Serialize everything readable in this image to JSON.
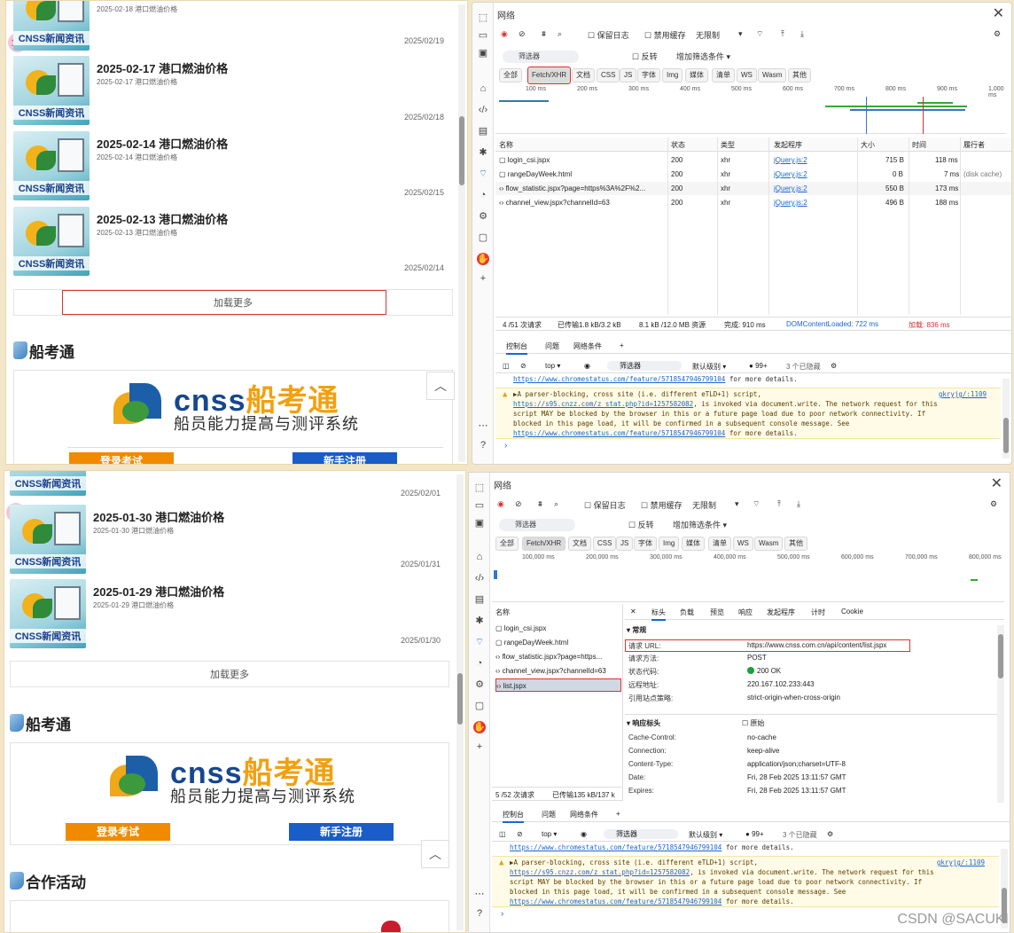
{
  "left_top": {
    "news": [
      {
        "title": "",
        "sub": "2025-02-18 港口燃油价格",
        "date": "2025/02/19"
      },
      {
        "title": "2025-02-17 港口燃油价格",
        "sub": "2025-02-17 港口燃油价格",
        "date": "2025/02/18"
      },
      {
        "title": "2025-02-14 港口燃油价格",
        "sub": "2025-02-14 港口燃油价格",
        "date": "2025/02/15"
      },
      {
        "title": "2025-02-13 港口燃油价格",
        "sub": "2025-02-13 港口燃油价格",
        "date": "2025/02/14"
      }
    ],
    "thumb_caption": "CNSS新闻资讯",
    "load_more": "加载更多",
    "section_title": "船考通",
    "logo_en": "cnss",
    "logo_cn": "船考通",
    "slogan": "船员能力提高与测评系统",
    "btn_exam": "登录考试",
    "btn_reg": "新手注册",
    "translate_badge": "文A"
  },
  "left_bottom": {
    "news": [
      {
        "title": "",
        "sub": "",
        "date": "2025/02/01"
      },
      {
        "title": "2025-01-30 港口燃油价格",
        "sub": "2025-01-30 港口燃油价格",
        "date": "2025/01/31"
      },
      {
        "title": "2025-01-29 港口燃油价格",
        "sub": "2025-01-29 港口燃油价格",
        "date": "2025/01/30"
      }
    ],
    "thumb_caption": "CNSS新闻资讯",
    "load_more": "加载更多",
    "section_title": "船考通",
    "section2_title": "合作活动",
    "logo_en": "cnss",
    "logo_cn": "船考通",
    "slogan": "船员能力提高与测评系统",
    "btn_exam": "登录考试",
    "btn_reg": "新手注册",
    "translate_badge": "文A"
  },
  "devtools": {
    "title": "网络",
    "preserve_log": "保留日志",
    "disable_cache": "禁用缓存",
    "throttle": "无限制",
    "filter": "筛选器",
    "invert": "反转",
    "more_filters": "增加筛选条件",
    "type_chips": [
      "全部",
      "Fetch/XHR",
      "文档",
      "CSS",
      "JS",
      "字体",
      "Img",
      "媒体",
      "清单",
      "WS",
      "Wasm",
      "其他"
    ],
    "ticks_top": [
      "100 ms",
      "200 ms",
      "300 ms",
      "400 ms",
      "500 ms",
      "600 ms",
      "700 ms",
      "800 ms",
      "900 ms",
      "1,000 ms"
    ],
    "ticks_bottom": [
      "100,000 ms",
      "200,000 ms",
      "300,000 ms",
      "400,000 ms",
      "500,000 ms",
      "600,000 ms",
      "700,000 ms",
      "800,000 ms"
    ],
    "columns": [
      "名称",
      "状态",
      "类型",
      "发起程序",
      "大小",
      "时间",
      "履行者"
    ],
    "rows": [
      {
        "name": "login_csi.jspx",
        "status": "200",
        "type": "xhr",
        "init": "jQuery.js:2",
        "size": "715 B",
        "time": "118 ms",
        "fulfilled": ""
      },
      {
        "name": "rangeDayWeek.html",
        "status": "200",
        "type": "xhr",
        "init": "jQuery.js:2",
        "size": "0 B",
        "time": "7 ms",
        "fulfilled": "(disk cache)"
      },
      {
        "name": "flow_statistic.jspx?page=https%3A%2F%2...",
        "status": "200",
        "type": "xhr",
        "init": "jQuery.js:2",
        "size": "550 B",
        "time": "173 ms",
        "fulfilled": ""
      },
      {
        "name": "channel_view.jspx?channelId=63",
        "status": "200",
        "type": "xhr",
        "init": "jQuery.js:2",
        "size": "496 B",
        "time": "188 ms",
        "fulfilled": ""
      }
    ],
    "summary": {
      "requests": "4 /51 次请求",
      "transferred": "已传输1.8 kB/3.2 kB",
      "resources": "8.1 kB /12.0 MB 资源",
      "finish": "完成: 910 ms",
      "dcl": "DOMContentLoaded: 722 ms",
      "load": "加载: 836 ms"
    },
    "drawer_tabs": [
      "控制台",
      "问题",
      "网络条件"
    ],
    "console_context": "top",
    "console_filter": "筛选器",
    "console_level": "默认级别",
    "issue_count": "99+",
    "hidden_count": "3 个已隐藏",
    "console_link_line": "https://www.chromestatus.com/feature/5718547946799104",
    "console_link_tail": " for more details.",
    "warn_prefix": "▶A parser-blocking, cross site (i.e. different eTLD+1) script,",
    "warn_link": "https://s95.cnzz.com/z_stat.php?id=1257582082",
    "warn_l2_tail": ", is invoked via document.write. The network request for this",
    "warn_l3": "script MAY be blocked by the browser in this or a future page load due to poor network connectivity. If",
    "warn_l4": "blocked in this page load, it will be confirmed in a subsequent console message. See",
    "warn_src": "gkryjg/:1109"
  },
  "devtools2": {
    "names": [
      "login_csi.jspx",
      "rangeDayWeek.html",
      "flow_statistic.jspx?page=https...",
      "channel_view.jspx?channelId=63",
      "list.jspx"
    ],
    "panel_tabs": [
      "标头",
      "负载",
      "预览",
      "响应",
      "发起程序",
      "计时",
      "Cookie"
    ],
    "general_title": "常规",
    "general": [
      {
        "k": "请求 URL:",
        "v": "https://www.cnss.com.cn/api/content/list.jspx"
      },
      {
        "k": "请求方法:",
        "v": "POST"
      },
      {
        "k": "状态代码:",
        "v": "200 OK"
      },
      {
        "k": "远程地址:",
        "v": "220.167.102.233:443"
      },
      {
        "k": "引用站点策略:",
        "v": "strict-origin-when-cross-origin"
      }
    ],
    "resp_title": "响应标头",
    "raw": "原始",
    "resp": [
      {
        "k": "Cache-Control:",
        "v": "no-cache"
      },
      {
        "k": "Connection:",
        "v": "keep-alive"
      },
      {
        "k": "Content-Type:",
        "v": "application/json;charset=UTF-8"
      },
      {
        "k": "Date:",
        "v": "Fri, 28 Feb 2025 13:11:57 GMT"
      },
      {
        "k": "Expires:",
        "v": "Fri, 28 Feb 2025 13:11:57 GMT"
      }
    ],
    "requests": "5 /52 次请求",
    "transferred": "已传输135 kB/137 k"
  },
  "watermark": "CSDN @SACUKI"
}
